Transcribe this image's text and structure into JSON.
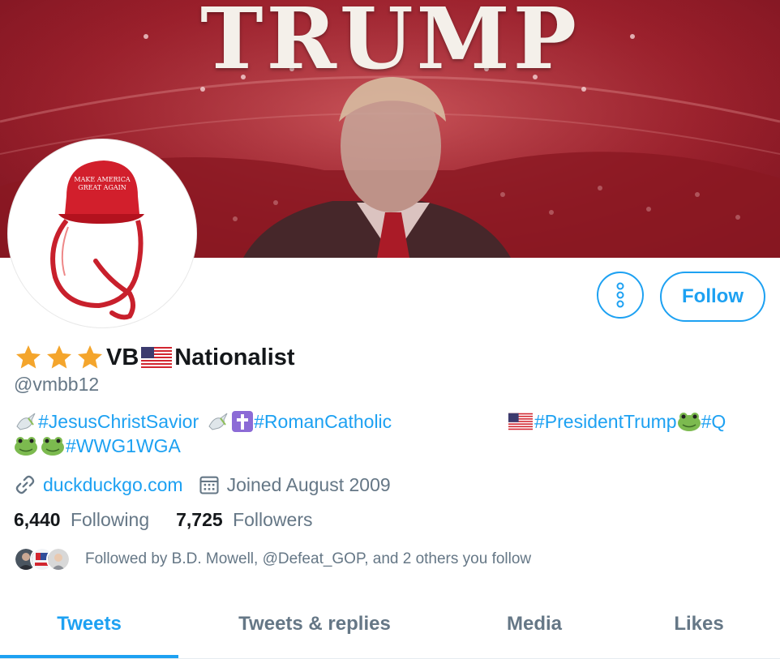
{
  "banner": {
    "title": "TRUMP"
  },
  "actions": {
    "follow_label": "Follow"
  },
  "profile": {
    "display_name_1": "VB",
    "display_name_2": "Nationalist",
    "handle": "@vmbb12",
    "website": "duckduckgo.com",
    "joined": "Joined August 2009",
    "avatar_cap_text_line1": "MAKE AMERICA",
    "avatar_cap_text_line2": "GREAT AGAIN"
  },
  "bio": {
    "tag_1": "#JesusChristSavior",
    "tag_2": "#RomanCatholic",
    "tag_3": "#PresidentTrump",
    "tag_4": "#Q",
    "tag_5": "#WWG1WGA"
  },
  "stats": {
    "following_count": "6,440",
    "following_label": "Following",
    "followers_count": "7,725",
    "followers_label": "Followers"
  },
  "followed_by": "Followed by B.D. Mowell, @Defeat_GOP, and 2 others you follow",
  "tabs": [
    "Tweets",
    "Tweets & replies",
    "Media",
    "Likes"
  ],
  "colors": {
    "accent": "#1da1f2",
    "muted": "#657786",
    "banner_red": "#9c1f2b"
  },
  "icons": {
    "stars": "star-icon",
    "flag": "us-flag-icon",
    "dove": "dove-icon",
    "cross": "cross-icon",
    "frog": "frog-icon",
    "link": "link-icon",
    "calendar": "calendar-icon",
    "more": "more-vertical-icon"
  }
}
